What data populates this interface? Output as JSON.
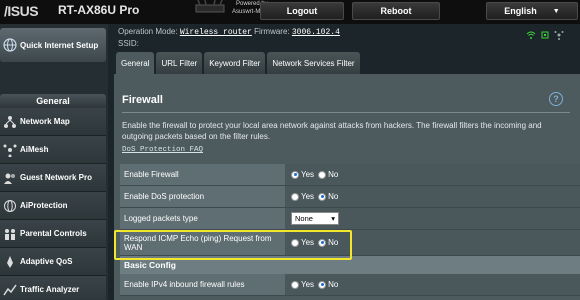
{
  "header": {
    "logo": "/ISUS",
    "model": "RT-AX86U Pro",
    "powered_by": "Powered by",
    "powered_by_name": "Asuswrt-Merlin",
    "logout_label": "Logout",
    "reboot_label": "Reboot",
    "language": "English"
  },
  "sidebar": {
    "qis_label": "Quick Internet Setup",
    "section_label": "General",
    "items": [
      {
        "label": "Network Map"
      },
      {
        "label": "AiMesh"
      },
      {
        "label": "Guest Network Pro"
      },
      {
        "label": "AiProtection"
      },
      {
        "label": "Parental Controls"
      },
      {
        "label": "Adaptive QoS"
      },
      {
        "label": "Traffic Analyzer"
      }
    ]
  },
  "info": {
    "op_mode_label": "Operation Mode:",
    "op_mode_value": "Wireless router",
    "firmware_label": "Firmware:",
    "firmware_value": "3006.102.4",
    "ssid_label": "SSID:"
  },
  "tabs": [
    {
      "label": "General"
    },
    {
      "label": "URL Filter"
    },
    {
      "label": "Keyword Filter"
    },
    {
      "label": "Network Services Filter"
    }
  ],
  "panel": {
    "title": "Firewall",
    "help": "?",
    "description": "Enable the firewall to protect your local area network against attacks from hackers. The firewall filters the incoming and outgoing packets based on the filter rules.",
    "faq_link": "DoS Protection FAQ"
  },
  "settings": {
    "enable_firewall": {
      "label": "Enable Firewall",
      "yes": "Yes",
      "no": "No",
      "selected": "Yes"
    },
    "enable_dos": {
      "label": "Enable DoS protection",
      "yes": "Yes",
      "no": "No",
      "selected": "No"
    },
    "logged_packets": {
      "label": "Logged packets type",
      "value": "None"
    },
    "icmp_echo": {
      "label": "Respond ICMP Echo (ping) Request from WAN",
      "yes": "Yes",
      "no": "No",
      "selected": "No"
    },
    "basic_config": "Basic Config",
    "ipv4_inbound": {
      "label": "Enable IPv4 inbound firewall rules",
      "yes": "Yes",
      "no": "No",
      "selected": "No"
    }
  },
  "colors": {
    "accent": "#1b6fd8",
    "highlight": "#f2e72a"
  }
}
